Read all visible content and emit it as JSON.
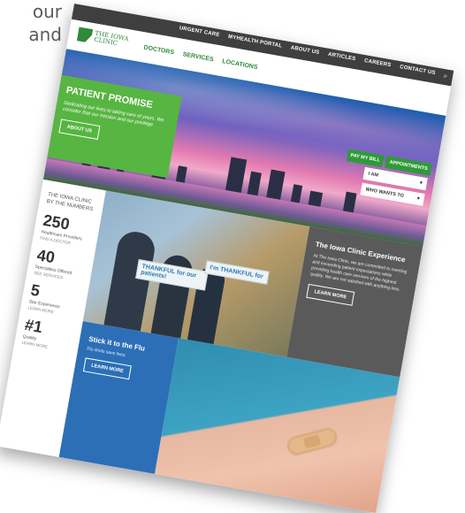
{
  "background_text": [
    "our",
    "and"
  ],
  "site": {
    "top_links": [
      "URGENT CARE",
      "MYHEALTH PORTAL",
      "ABOUT US",
      "ARTICLES",
      "CAREERS",
      "CONTACT US"
    ],
    "logo_text": [
      "THE IOWA",
      "CLINIC"
    ],
    "main_nav": [
      "DOCTORS",
      "SERVICES",
      "LOCATIONS"
    ],
    "hero_buttons": [
      "PAY MY BILL",
      "APPOINTMENTS"
    ],
    "patient_promise": {
      "title": "PATIENT PROMISE",
      "text": "Dedicating our lives to taking care of yours. We consider that our mission and our privilege.",
      "button": "ABOUT US"
    },
    "selects": [
      {
        "label": "I AM",
        "icon": "chevron-down-icon"
      },
      {
        "label": "WHO WANTS TO",
        "icon": "chevron-down-icon"
      }
    ],
    "stats_header": [
      "THE IOWA CLINIC",
      "BY THE NUMBERS"
    ],
    "stats": [
      {
        "num": "250",
        "label": "Healthcare Providers",
        "link": "FIND A DOCTOR"
      },
      {
        "num": "40",
        "label": "Specialties Offered",
        "link": "SEE SERVICES"
      },
      {
        "num": "5",
        "label": "Star Experience",
        "link": "LEARN MORE"
      },
      {
        "num": "#1",
        "label": "Quality",
        "link": "LEARN MORE"
      }
    ],
    "photo_signs": [
      "THANKFUL for our patients!",
      "I'm THANKFUL for"
    ],
    "experience": {
      "title": "The Iowa Clinic Experience",
      "text": "At The Iowa Clinic, we are committed to meeting and exceeding patient expectations while providing health care services of the highest quality. We are not satisfied with anything less.",
      "button": "LEARN MORE"
    },
    "flu": {
      "title": "Stick it to the Flu",
      "text": "Flu shots save lives.",
      "button": "LEARN MORE"
    }
  },
  "colors": {
    "green": "#57b541",
    "dark": "#3f3f3f",
    "blue": "#2c6fb7",
    "gray": "#5a5a5a"
  }
}
